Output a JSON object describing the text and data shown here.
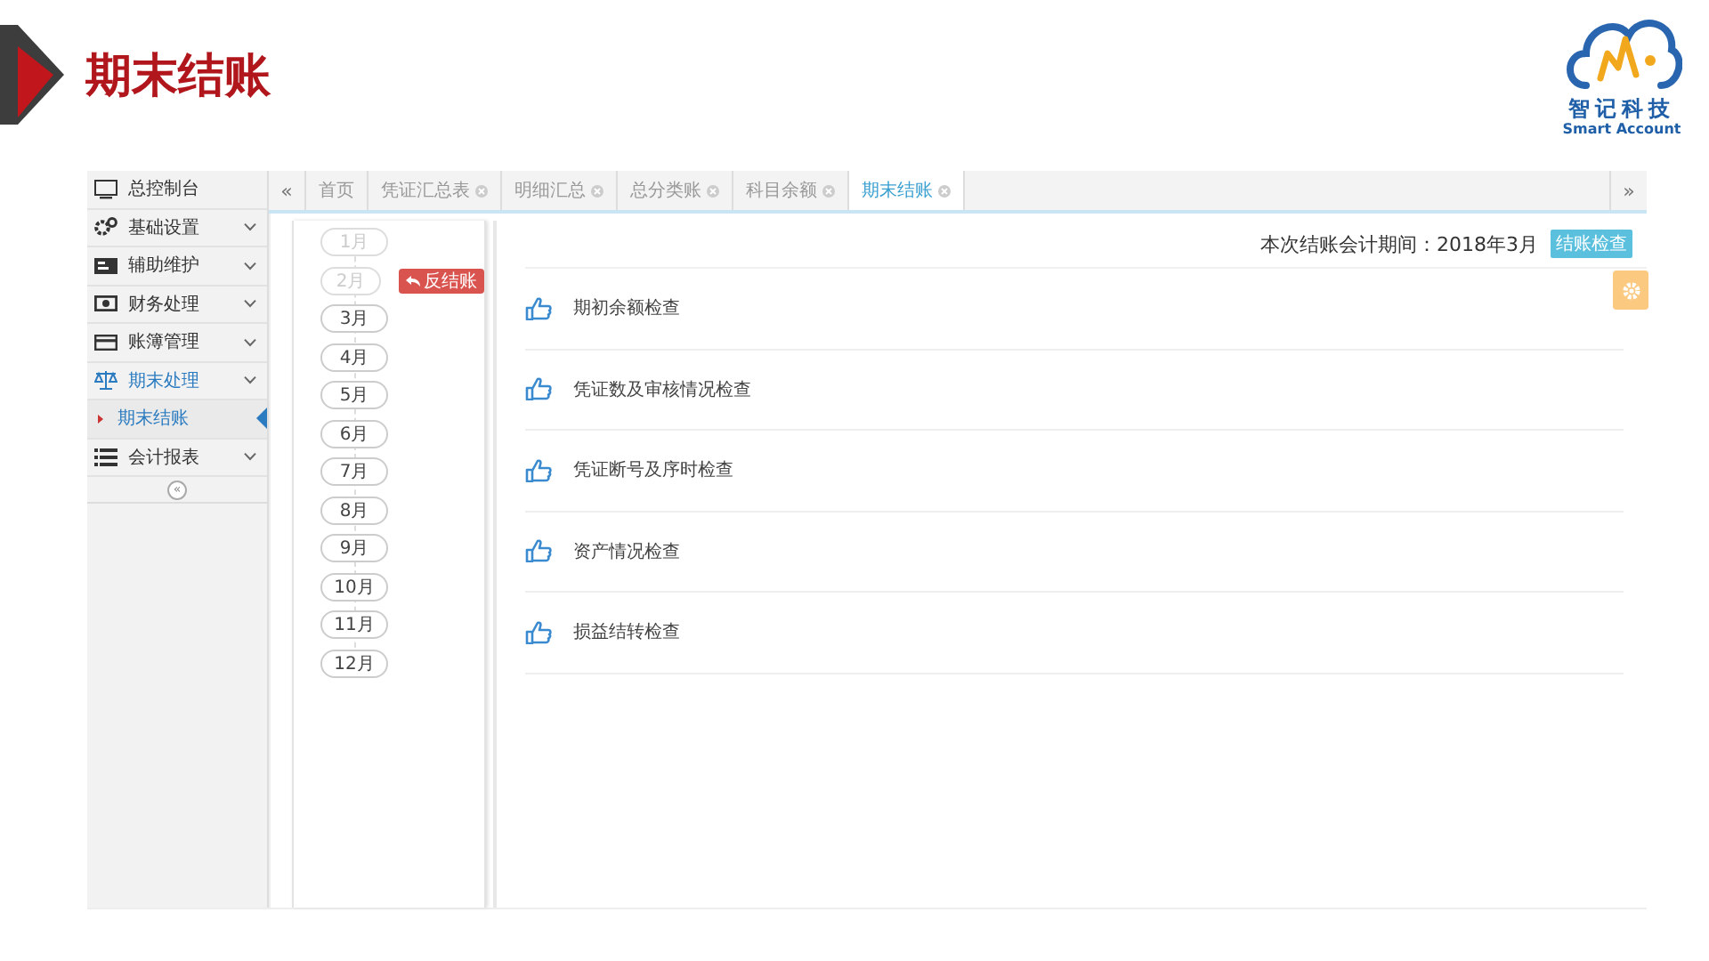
{
  "slide": {
    "title": "期末结账",
    "logo": {
      "name": "智记科技",
      "tagline": "Smart Account"
    }
  },
  "sidebar": {
    "items": [
      {
        "label": "总控制台",
        "expandable": false,
        "selected": false
      },
      {
        "label": "基础设置",
        "expandable": true,
        "selected": false
      },
      {
        "label": "辅助维护",
        "expandable": true,
        "selected": false
      },
      {
        "label": "财务处理",
        "expandable": true,
        "selected": false
      },
      {
        "label": "账簿管理",
        "expandable": true,
        "selected": false
      },
      {
        "label": "期末处理",
        "expandable": true,
        "selected": true,
        "children": [
          {
            "label": "期末结账",
            "selected": true
          }
        ]
      },
      {
        "label": "会计报表",
        "expandable": true,
        "selected": false
      }
    ],
    "collapse": "«"
  },
  "tabs": {
    "prev": "«",
    "next": "»",
    "items": [
      {
        "label": "首页",
        "closable": false,
        "selected": false
      },
      {
        "label": "凭证汇总表",
        "closable": true,
        "selected": false
      },
      {
        "label": "明细汇总",
        "closable": true,
        "selected": false
      },
      {
        "label": "总分类账",
        "closable": true,
        "selected": false
      },
      {
        "label": "科目余额",
        "closable": true,
        "selected": false
      },
      {
        "label": "期末结账",
        "closable": true,
        "selected": true
      }
    ]
  },
  "months": [
    {
      "label": "1月",
      "closed": true
    },
    {
      "label": "2月",
      "closed": true
    },
    {
      "label": "3月",
      "closed": false
    },
    {
      "label": "4月",
      "closed": false
    },
    {
      "label": "5月",
      "closed": false
    },
    {
      "label": "6月",
      "closed": false
    },
    {
      "label": "7月",
      "closed": false
    },
    {
      "label": "8月",
      "closed": false
    },
    {
      "label": "9月",
      "closed": false
    },
    {
      "label": "10月",
      "closed": false
    },
    {
      "label": "11月",
      "closed": false
    },
    {
      "label": "12月",
      "closed": false
    }
  ],
  "reopen_button": "反结账",
  "panel": {
    "period": "本次结账会计期间：2018年3月",
    "check_button": "结账检查",
    "checks": [
      "期初余额检查",
      "凭证数及审核情况检查",
      "凭证断号及序时检查",
      "资产情况检查",
      "损益结转检查"
    ]
  }
}
